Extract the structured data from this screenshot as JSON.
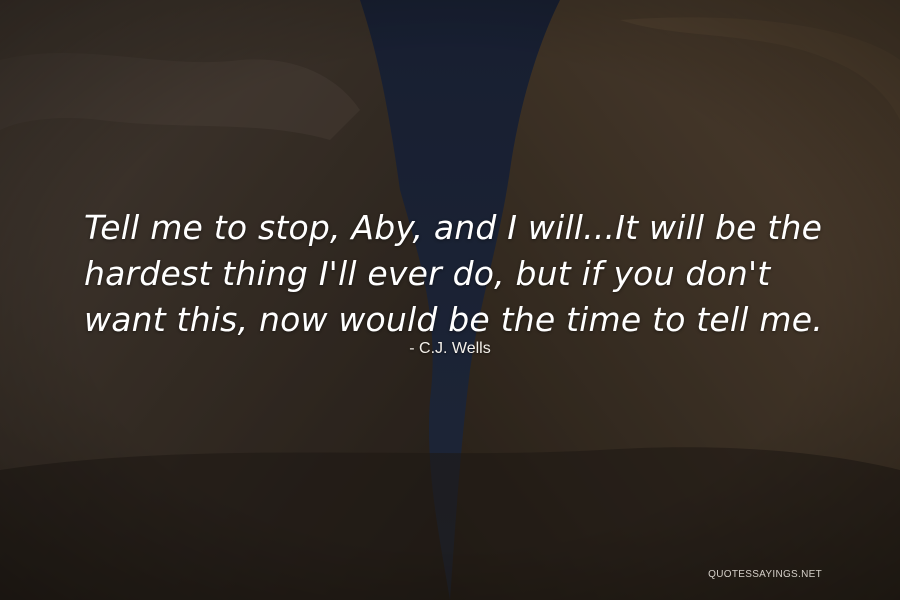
{
  "quote": {
    "text": "Tell me to stop, Aby, and I will...It will be the hardest thing I'll ever do, but if you don't want this, now would be the time to tell me.",
    "author": "- C.J. Wells"
  },
  "watermark": {
    "text": "QUOTESSAYINGS.NET"
  },
  "colors": {
    "sky": "#1f2c4a",
    "rock_left": "#4d4037",
    "rock_right": "#5c4a38",
    "text": "#ffffff"
  }
}
